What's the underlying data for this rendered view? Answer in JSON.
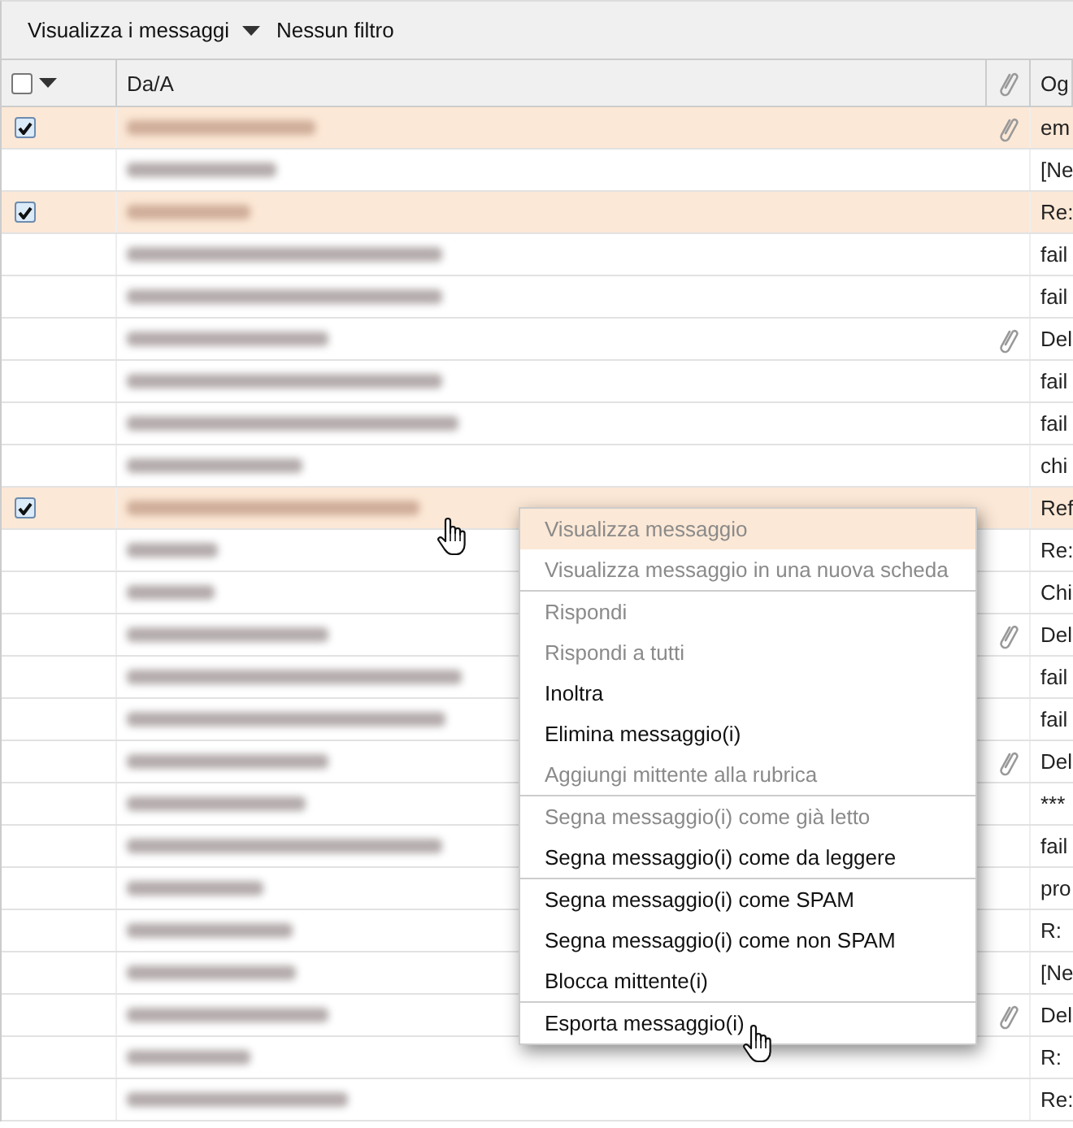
{
  "toolbar": {
    "view_menu": "Visualizza i messaggi",
    "filter": "Nessun filtro"
  },
  "table": {
    "select_all_checked": false,
    "sender_column": "Da/A",
    "subject_column": "Og",
    "rows": [
      {
        "checked": true,
        "attachment": true,
        "subject": "em"
      },
      {
        "checked": false,
        "attachment": false,
        "subject": "[Ne"
      },
      {
        "checked": true,
        "attachment": false,
        "subject": "Re:"
      },
      {
        "checked": false,
        "attachment": false,
        "subject": "fail"
      },
      {
        "checked": false,
        "attachment": false,
        "subject": "fail"
      },
      {
        "checked": false,
        "attachment": true,
        "subject": "Del"
      },
      {
        "checked": false,
        "attachment": false,
        "subject": "fail"
      },
      {
        "checked": false,
        "attachment": false,
        "subject": "fail"
      },
      {
        "checked": false,
        "attachment": false,
        "subject": "chi"
      },
      {
        "checked": true,
        "attachment": false,
        "subject": "Ref"
      },
      {
        "checked": false,
        "attachment": false,
        "subject": "Re:"
      },
      {
        "checked": false,
        "attachment": false,
        "subject": "Chi"
      },
      {
        "checked": false,
        "attachment": true,
        "subject": "Del"
      },
      {
        "checked": false,
        "attachment": false,
        "subject": "fail"
      },
      {
        "checked": false,
        "attachment": false,
        "subject": "fail"
      },
      {
        "checked": false,
        "attachment": true,
        "subject": "Del"
      },
      {
        "checked": false,
        "attachment": false,
        "subject": "***"
      },
      {
        "checked": false,
        "attachment": false,
        "subject": "fail"
      },
      {
        "checked": false,
        "attachment": false,
        "subject": "pro"
      },
      {
        "checked": false,
        "attachment": false,
        "subject": "R:"
      },
      {
        "checked": false,
        "attachment": false,
        "subject": "[Ne"
      },
      {
        "checked": false,
        "attachment": true,
        "subject": "Del"
      },
      {
        "checked": false,
        "attachment": false,
        "subject": "R:"
      },
      {
        "checked": false,
        "attachment": false,
        "subject": "Re:"
      }
    ]
  },
  "context_menu": {
    "sections": [
      [
        {
          "label": "Visualizza messaggio",
          "disabled": true,
          "selected": true
        },
        {
          "label": "Visualizza messaggio in una nuova scheda",
          "disabled": true,
          "selected": false
        }
      ],
      [
        {
          "label": "Rispondi",
          "disabled": true,
          "selected": false
        },
        {
          "label": "Rispondi a tutti",
          "disabled": true,
          "selected": false
        },
        {
          "label": "Inoltra",
          "disabled": false,
          "selected": false
        },
        {
          "label": "Elimina messaggio(i)",
          "disabled": false,
          "selected": false
        },
        {
          "label": "Aggiungi mittente alla rubrica",
          "disabled": true,
          "selected": false
        }
      ],
      [
        {
          "label": "Segna messaggio(i) come già letto",
          "disabled": true,
          "selected": false
        },
        {
          "label": "Segna messaggio(i) come da leggere",
          "disabled": false,
          "selected": false
        }
      ],
      [
        {
          "label": "Segna messaggio(i) come SPAM",
          "disabled": false,
          "selected": false
        },
        {
          "label": "Segna messaggio(i) come non SPAM",
          "disabled": false,
          "selected": false
        },
        {
          "label": "Blocca mittente(i)",
          "disabled": false,
          "selected": false
        }
      ],
      [
        {
          "label": "Esporta messaggio(i)",
          "disabled": false,
          "selected": false
        }
      ]
    ]
  }
}
